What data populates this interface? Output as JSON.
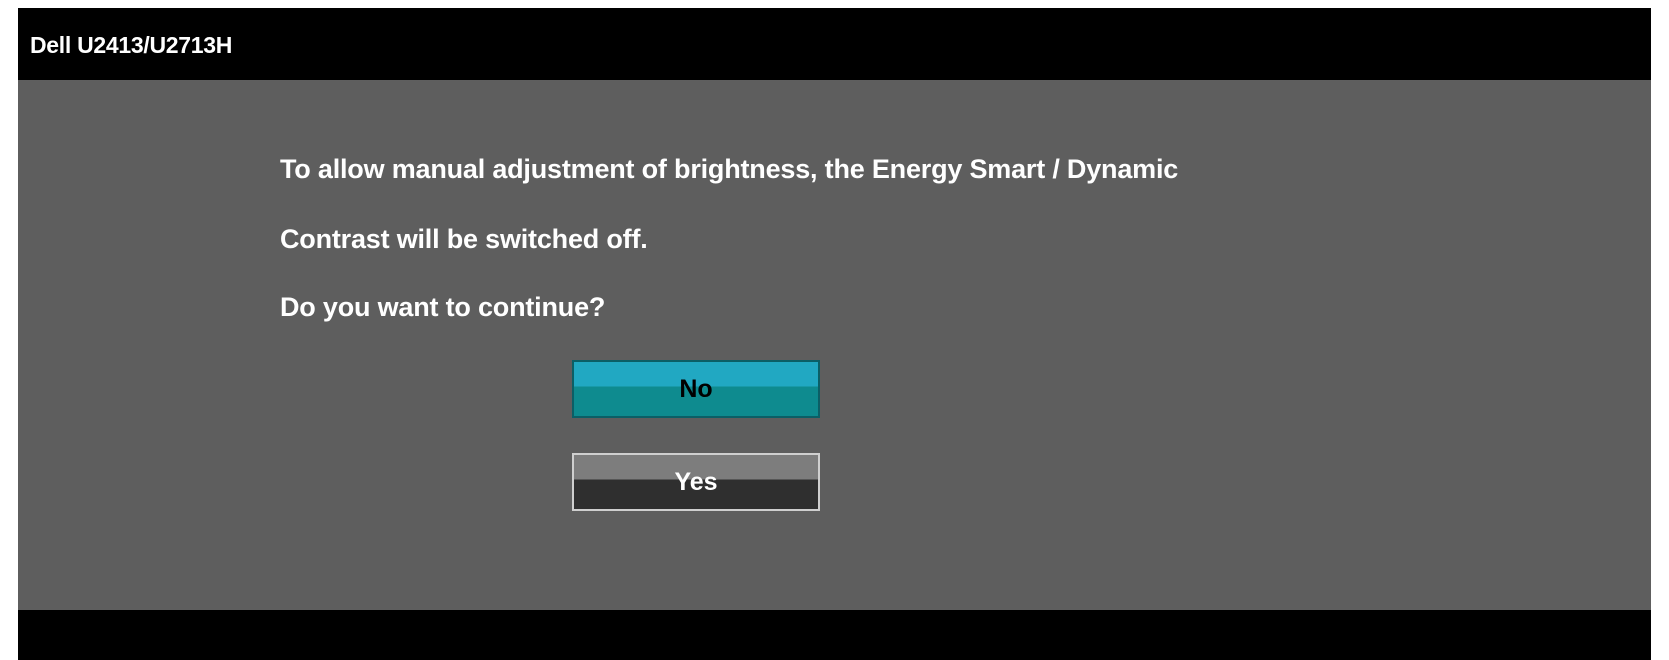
{
  "window": {
    "title": "Dell U2413/U2713H"
  },
  "dialog": {
    "message_lines": [
      "To allow manual adjustment of brightness, the Energy Smart / Dynamic",
      "Contrast will be switched off.",
      "Do you want to continue?"
    ],
    "buttons": {
      "no_label": "No",
      "yes_label": "Yes",
      "selected": "No"
    }
  },
  "colors": {
    "title_bar": "#000000",
    "body_background": "#5e5e5e",
    "selected_button_top": "#21a8c2",
    "selected_button_bottom": "#0e8b8f",
    "unselected_button_top": "#7d7d7d",
    "unselected_button_bottom": "#2f2f2f",
    "text": "#ffffff"
  }
}
